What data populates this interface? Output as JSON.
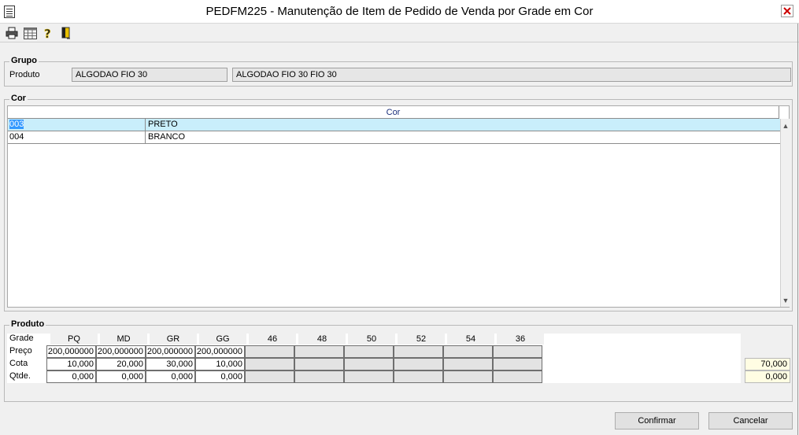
{
  "window": {
    "title": "PEDFM225 - Manutenção de Item de Pedido de Venda por Grade em Cor"
  },
  "toolbar": {
    "icons": [
      "printer-icon",
      "grid-icon",
      "help-icon",
      "exit-door-icon"
    ]
  },
  "grupo": {
    "legend": "Grupo",
    "produto_label": "Produto",
    "produto_code": "ALGODAO FIO 30",
    "produto_desc": "ALGODAO FIO 30 FIO 30"
  },
  "cor": {
    "legend": "Cor",
    "column_header": "Cor",
    "rows": [
      {
        "code": "003",
        "name": "PRETO"
      },
      {
        "code": "004",
        "name": "BRANCO"
      }
    ]
  },
  "produto": {
    "legend": "Produto",
    "row_labels": {
      "grade": "Grade",
      "preco": "Preço",
      "cota": "Cota",
      "qtde": "Qtde."
    },
    "sizes": [
      "PQ",
      "MD",
      "GR",
      "GG",
      "46",
      "48",
      "50",
      "52",
      "54",
      "36"
    ],
    "preco": [
      "200,000000",
      "200,000000",
      "200,000000",
      "200,000000",
      "",
      "",
      "",
      "",
      "",
      ""
    ],
    "cota": [
      "10,000",
      "20,000",
      "30,000",
      "10,000",
      "",
      "",
      "",
      "",
      "",
      ""
    ],
    "qtde": [
      "0,000",
      "0,000",
      "0,000",
      "0,000",
      "",
      "",
      "",
      "",
      "",
      ""
    ],
    "total_cota": "70,000",
    "total_qtde": "0,000"
  },
  "buttons": {
    "confirm": "Confirmar",
    "cancel": "Cancelar"
  },
  "colors": {
    "selected_row": "#c9eefb",
    "focus": "#3399ff",
    "total_bg": "#fffde3",
    "header_text": "#1a2f7a"
  }
}
